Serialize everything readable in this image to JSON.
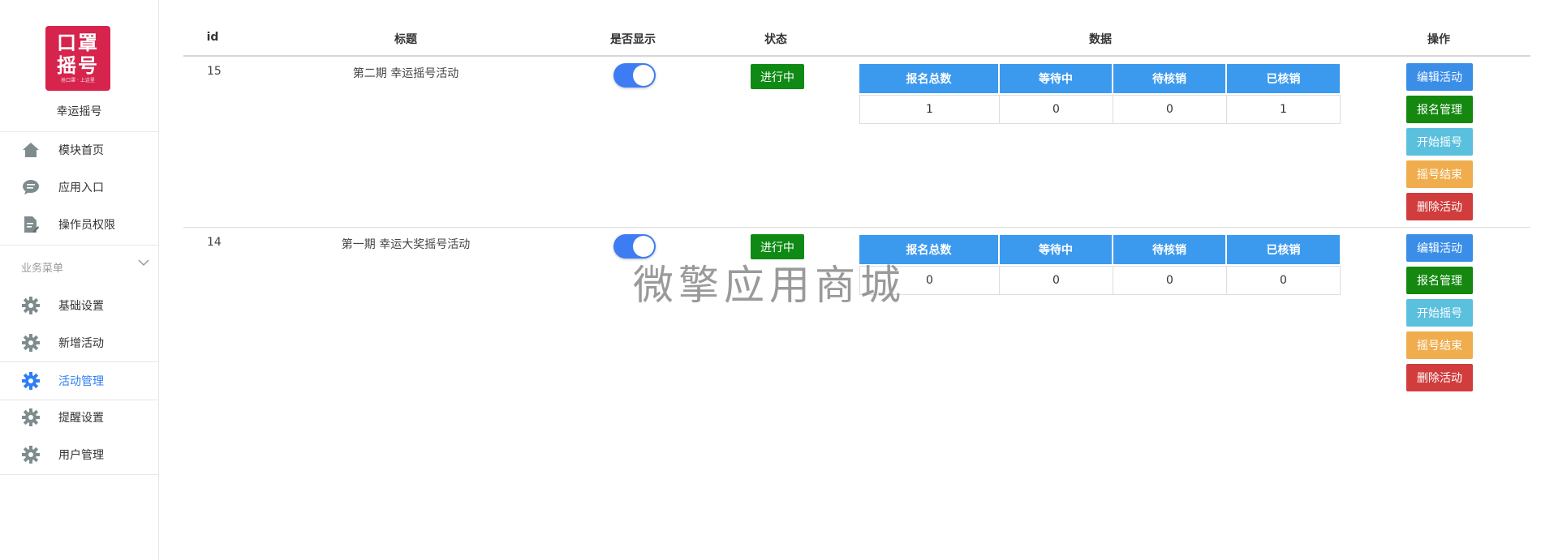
{
  "sidebar": {
    "logo": {
      "line1": "口罩",
      "line2": "摇号",
      "small": "抢口罩 · 上这里"
    },
    "app_name": "幸运摇号",
    "top_items": [
      {
        "label": "模块首页",
        "icon": "home-icon"
      },
      {
        "label": "应用入口",
        "icon": "chat-icon"
      },
      {
        "label": "操作员权限",
        "icon": "document-edit-icon"
      }
    ],
    "group_title": "业务菜单",
    "group_items": [
      {
        "label": "基础设置",
        "icon": "gear-icon"
      },
      {
        "label": "新增活动",
        "icon": "gear-icon"
      },
      {
        "label": "活动管理",
        "icon": "gear-icon",
        "active": true
      },
      {
        "label": "提醒设置",
        "icon": "gear-icon"
      },
      {
        "label": "用户管理",
        "icon": "gear-icon"
      }
    ]
  },
  "table": {
    "headers": {
      "id": "id",
      "title": "标题",
      "show": "是否显示",
      "status": "状态",
      "data": "数据",
      "ops": "操作"
    },
    "stat_headers": [
      "报名总数",
      "等待中",
      "待核销",
      "已核销"
    ],
    "rows": [
      {
        "id": "15",
        "title": "第二期 幸运摇号活动",
        "show": true,
        "status": "进行中",
        "stats": [
          "1",
          "0",
          "0",
          "1"
        ]
      },
      {
        "id": "14",
        "title": "第一期 幸运大奖摇号活动",
        "show": true,
        "status": "进行中",
        "stats": [
          "0",
          "0",
          "0",
          "0"
        ]
      }
    ],
    "ops": [
      "编辑活动",
      "报名管理",
      "开始摇号",
      "摇号结束",
      "删除活动"
    ]
  },
  "watermark": "微擎应用商城",
  "colors": {
    "accent": "#2f7ff0",
    "status_green": "#0f8a15",
    "header_blue": "#3c9aee",
    "logo_red": "#d6244d"
  }
}
